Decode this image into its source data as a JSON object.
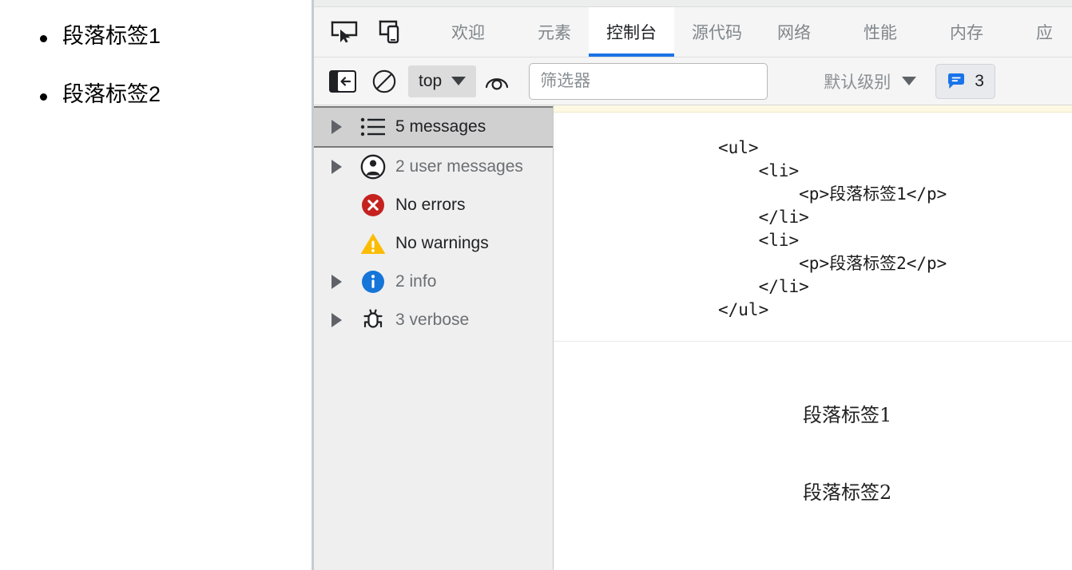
{
  "page": {
    "list_items": [
      "段落标签1",
      "段落标签2"
    ]
  },
  "devtools": {
    "toolbar_icons": [
      {
        "name": "inspect-element-icon",
        "label": "检查元素"
      },
      {
        "name": "device-toolbar-icon",
        "label": "切换设备工具栏"
      }
    ],
    "tabs": [
      {
        "label": "欢迎",
        "active": false
      },
      {
        "label": "元素",
        "active": false
      },
      {
        "label": "控制台",
        "active": true
      },
      {
        "label": "源代码",
        "active": false
      },
      {
        "label": "网络",
        "active": false
      },
      {
        "label": "性能",
        "active": false
      },
      {
        "label": "内存",
        "active": false
      },
      {
        "label": "应",
        "active": false
      }
    ],
    "console_toolbar": {
      "sidebar_toggle_label": "显示控制台侧边栏",
      "clear_console_label": "清除控制台",
      "context_selector": "top",
      "live_expression_label": "创建实时表达式",
      "filter_placeholder": "筛选器",
      "filter_value": "",
      "level_selector": "默认级别",
      "message_count": "3"
    },
    "sidebar": [
      {
        "icon": "list-icon",
        "label": "5 messages",
        "twisty": true,
        "selected": true,
        "muted": false
      },
      {
        "icon": "user-icon",
        "label": "2 user messages",
        "twisty": true,
        "selected": false,
        "muted": true
      },
      {
        "icon": "error-icon",
        "label": "No errors",
        "twisty": false,
        "selected": false,
        "muted": false
      },
      {
        "icon": "warning-icon",
        "label": "No warnings",
        "twisty": false,
        "selected": false,
        "muted": false
      },
      {
        "icon": "info-icon",
        "label": "2 info",
        "twisty": true,
        "selected": false,
        "muted": true
      },
      {
        "icon": "verbose-icon",
        "label": "3 verbose",
        "twisty": true,
        "selected": false,
        "muted": true
      }
    ],
    "output": {
      "code_lines": [
        {
          "text": "<ul>",
          "indent": 0
        },
        {
          "text": "<li>",
          "indent": 1
        },
        {
          "text": "<p>段落标签1</p>",
          "indent": 2
        },
        {
          "text": "</li>",
          "indent": 1
        },
        {
          "text": "<li>",
          "indent": 1
        },
        {
          "text": "<p>段落标签2</p>",
          "indent": 2
        },
        {
          "text": "</li>",
          "indent": 1
        },
        {
          "text": "</ul>",
          "indent": 0
        }
      ],
      "rendered_lines": [
        "段落标签1",
        "段落标签2"
      ]
    }
  },
  "colors": {
    "accent": "#1a73e8",
    "error": "#c5221f",
    "warning": "#fbbc04",
    "info": "#1a73e8",
    "sidebar_bg": "#efefef",
    "selected_row": "#d0d0d0"
  }
}
